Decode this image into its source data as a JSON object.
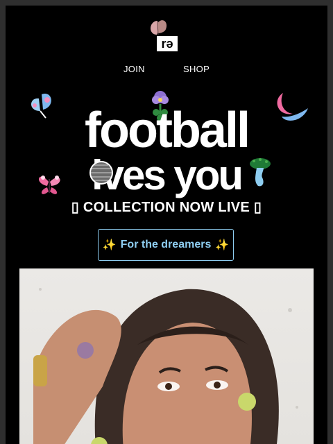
{
  "brand": {
    "logo_text": "rə"
  },
  "nav": {
    "join_label": "JOIN",
    "shop_label": "SHOP"
  },
  "headline": {
    "line1": "football",
    "line2": "lves you"
  },
  "collection": {
    "text": "COLLECTION NOW LIVE",
    "left_glyph": "▯",
    "right_glyph": "▯"
  },
  "cta": {
    "label": "For the dreamers",
    "sparkle_left": "✨",
    "sparkle_right": "✨"
  },
  "colors": {
    "background": "#000000",
    "outer": "#2f2f2f",
    "accent_blue": "#8ecdf0",
    "butterfly_pink": "#f06aa0",
    "butterfly_blue": "#7fb8ef",
    "flower_purple": "#8d6fd1",
    "leaf_green": "#2f8a3f"
  },
  "icons": [
    "butterfly-logo-icon",
    "butterfly-blue-icon",
    "pansy-flower-icon",
    "moon-icon",
    "butterfly-pink-icon",
    "soccer-ball-icon",
    "mushroom-icon"
  ]
}
